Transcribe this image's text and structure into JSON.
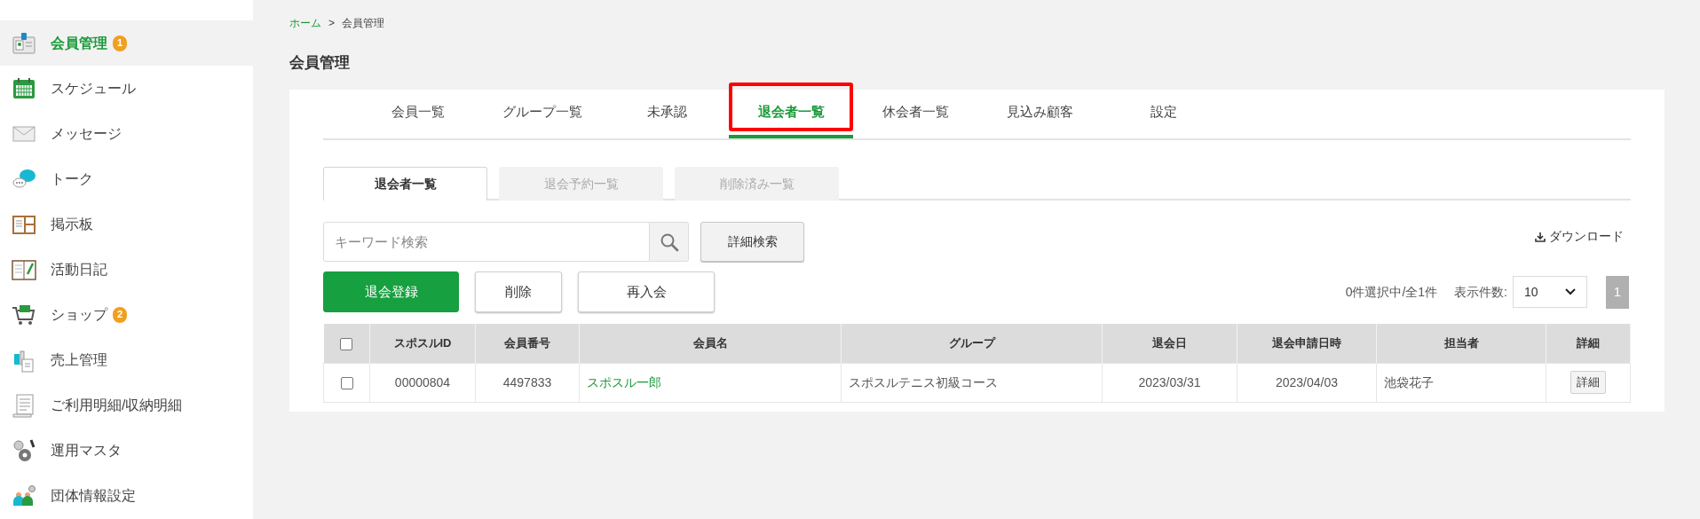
{
  "sidebar": {
    "items": [
      {
        "label": "会員管理",
        "badge": "1",
        "selected": true
      },
      {
        "label": "スケジュール",
        "selected": false
      },
      {
        "label": "メッセージ",
        "selected": false
      },
      {
        "label": "トーク",
        "selected": false
      },
      {
        "label": "掲示板",
        "selected": false
      },
      {
        "label": "活動日記",
        "selected": false
      },
      {
        "label": "ショップ",
        "badge": "2",
        "selected": false
      },
      {
        "label": "売上管理",
        "selected": false
      },
      {
        "label": "ご利用明細/収納明細",
        "selected": false
      },
      {
        "label": "運用マスタ",
        "selected": false
      },
      {
        "label": "団体情報設定",
        "selected": false
      }
    ]
  },
  "breadcrumb": [
    {
      "label": "ホーム",
      "link": true
    },
    {
      "label": ">",
      "link": false
    },
    {
      "label": "会員管理",
      "link": false
    }
  ],
  "page_title": "会員管理",
  "tabs": [
    {
      "label": "会員一覧",
      "selected": false,
      "annotated": false
    },
    {
      "label": "グループ一覧",
      "selected": false,
      "annotated": false
    },
    {
      "label": "未承認",
      "selected": false,
      "annotated": false
    },
    {
      "label": "退会者一覧",
      "selected": true,
      "annotated": true
    },
    {
      "label": "休会者一覧",
      "selected": false,
      "annotated": false
    },
    {
      "label": "見込み顧客",
      "selected": false,
      "annotated": false
    },
    {
      "label": "設定",
      "selected": false,
      "annotated": false
    }
  ],
  "sub_tabs": [
    {
      "label": "退会者一覧",
      "selected": true
    },
    {
      "label": "退会予約一覧",
      "selected": false
    },
    {
      "label": "削除済み一覧",
      "selected": false
    }
  ],
  "search": {
    "placeholder": "キーワード検索"
  },
  "advanced_search_button": "詳細検索",
  "download_link": "ダウンロード",
  "actions": [
    {
      "label": "退会登録",
      "kind": "primary"
    },
    {
      "label": "削除",
      "kind": "secondary"
    },
    {
      "label": "再入会",
      "kind": "secondary"
    }
  ],
  "selection_count": "0件選択中/全1件",
  "page_size": {
    "label": "表示件数:",
    "value": "10"
  },
  "pages": [
    {
      "label": "1",
      "selected": true
    }
  ],
  "table": {
    "header_checked": false,
    "columns": [
      "スポスルID",
      "会員番号",
      "会員名",
      "グループ",
      "退会日",
      "退会申請日時",
      "担当者",
      "詳細"
    ],
    "rows": [
      {
        "checked": false,
        "cells": [
          "00000804",
          "4497833",
          "スポスル一郎",
          "スポスルテニス初級コース",
          "2023/03/31",
          "2023/04/03",
          "池袋花子"
        ],
        "detail_button": "詳細"
      }
    ]
  }
}
